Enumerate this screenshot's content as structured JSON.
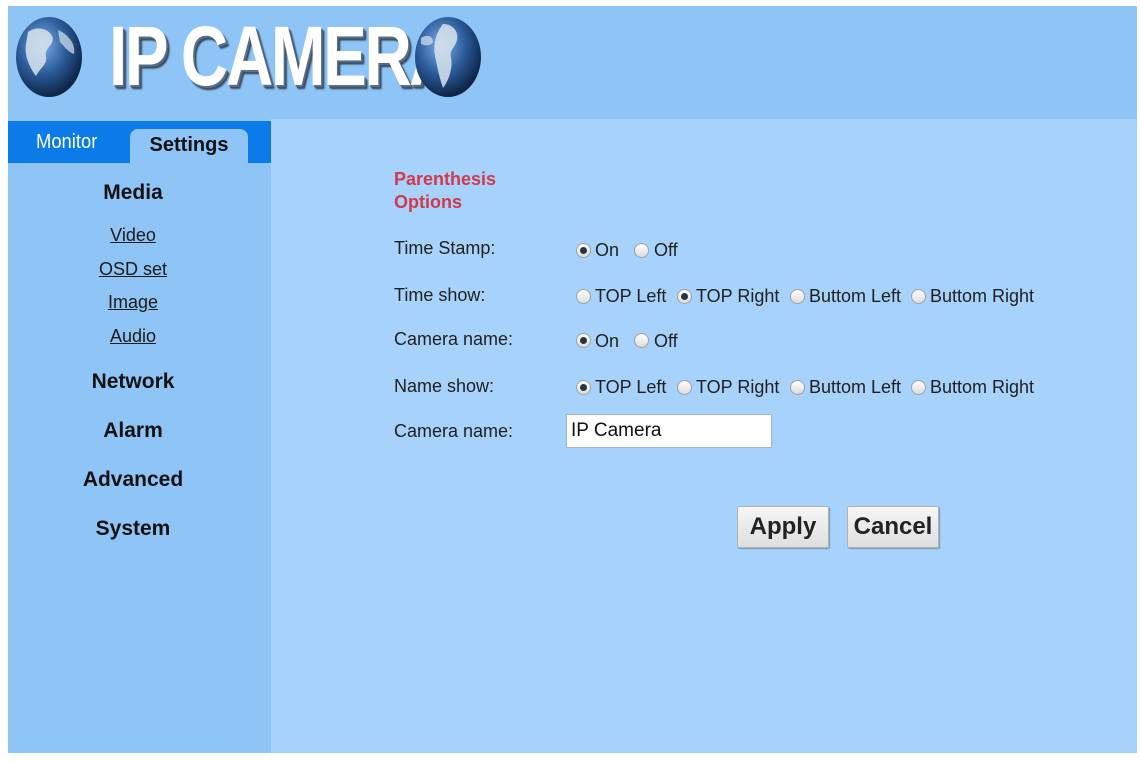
{
  "header": {
    "logo_text": "IP CAMERA"
  },
  "sidebar": {
    "tabs": [
      {
        "label": "Monitor",
        "active": false
      },
      {
        "label": "Settings",
        "active": true
      }
    ],
    "media": {
      "label": "Media",
      "items": [
        "Video",
        "OSD set",
        "Image",
        "Audio"
      ]
    },
    "sections": [
      "Network",
      "Alarm",
      "Advanced",
      "System"
    ]
  },
  "form": {
    "section_title": "Parenthesis Options",
    "time_stamp": {
      "label": "Time Stamp:",
      "options": [
        "On",
        "Off"
      ],
      "selected": "On"
    },
    "time_show": {
      "label": "Time show:",
      "options": [
        "TOP Left",
        "TOP Right",
        "Buttom Left",
        "Buttom Right"
      ],
      "selected": "TOP Right"
    },
    "camera_name_toggle": {
      "label": "Camera name:",
      "options": [
        "On",
        "Off"
      ],
      "selected": "On"
    },
    "name_show": {
      "label": "Name show:",
      "options": [
        "TOP Left",
        "TOP Right",
        "Buttom Left",
        "Buttom Right"
      ],
      "selected": "TOP Left"
    },
    "camera_name_field": {
      "label": "Camera name:",
      "value": "IP Camera"
    },
    "apply_label": "Apply",
    "cancel_label": "Cancel"
  },
  "colors": {
    "header_bg": "#8ec5f6",
    "sidebar_bg": "#8ec5f6",
    "content_bg": "#a6d2fb",
    "tabbar_bg": "#0a7be8",
    "section_title": "#d03a4a"
  }
}
